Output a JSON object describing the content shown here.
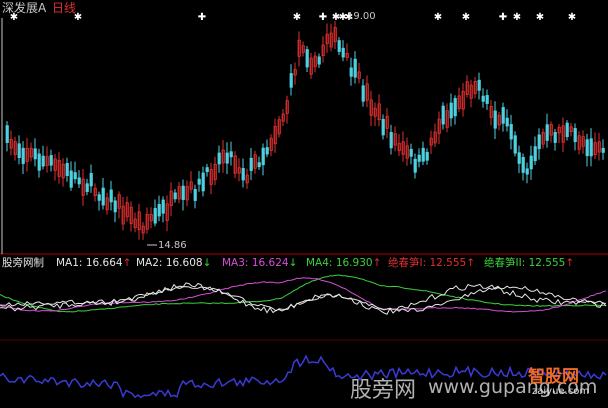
{
  "header": {
    "stock_name": "深发展A",
    "period": "日线"
  },
  "price_labels": {
    "high": "19.00",
    "low": "14.86"
  },
  "indicator": {
    "name": "股旁网制",
    "items": [
      {
        "label": "MA1:",
        "value": "16.664",
        "arrow": "↑",
        "color": "#e6e6e6"
      },
      {
        "label": "MA2:",
        "value": "16.608",
        "arrow": "↓",
        "color": "#e6e6e6"
      },
      {
        "label": "MA3:",
        "value": "16.624",
        "arrow": "↓",
        "color": "#d64fd6"
      },
      {
        "label": "MA4:",
        "value": "16.930",
        "arrow": "↑",
        "color": "#3cd23c"
      },
      {
        "label": "绝春笋I:",
        "value": "12.555",
        "arrow": "↑",
        "color": "#e03030"
      },
      {
        "label": "绝春笋II:",
        "value": "12.555",
        "arrow": "↑",
        "color": "#3cd23c"
      }
    ]
  },
  "watermarks": {
    "site_cn": "股旁网",
    "site_url": "www.gupang.com",
    "logo_text": "智股网",
    "logo_url": "zaiyue.com"
  },
  "colors": {
    "up_candle": "#e03030",
    "down_candle": "#4fd0e0",
    "ma_white": "#e6e6e6",
    "ma_magenta": "#d64fd6",
    "ma_green": "#3cd23c",
    "volume_line": "#3a3ad6",
    "grid": "#b00000"
  }
}
